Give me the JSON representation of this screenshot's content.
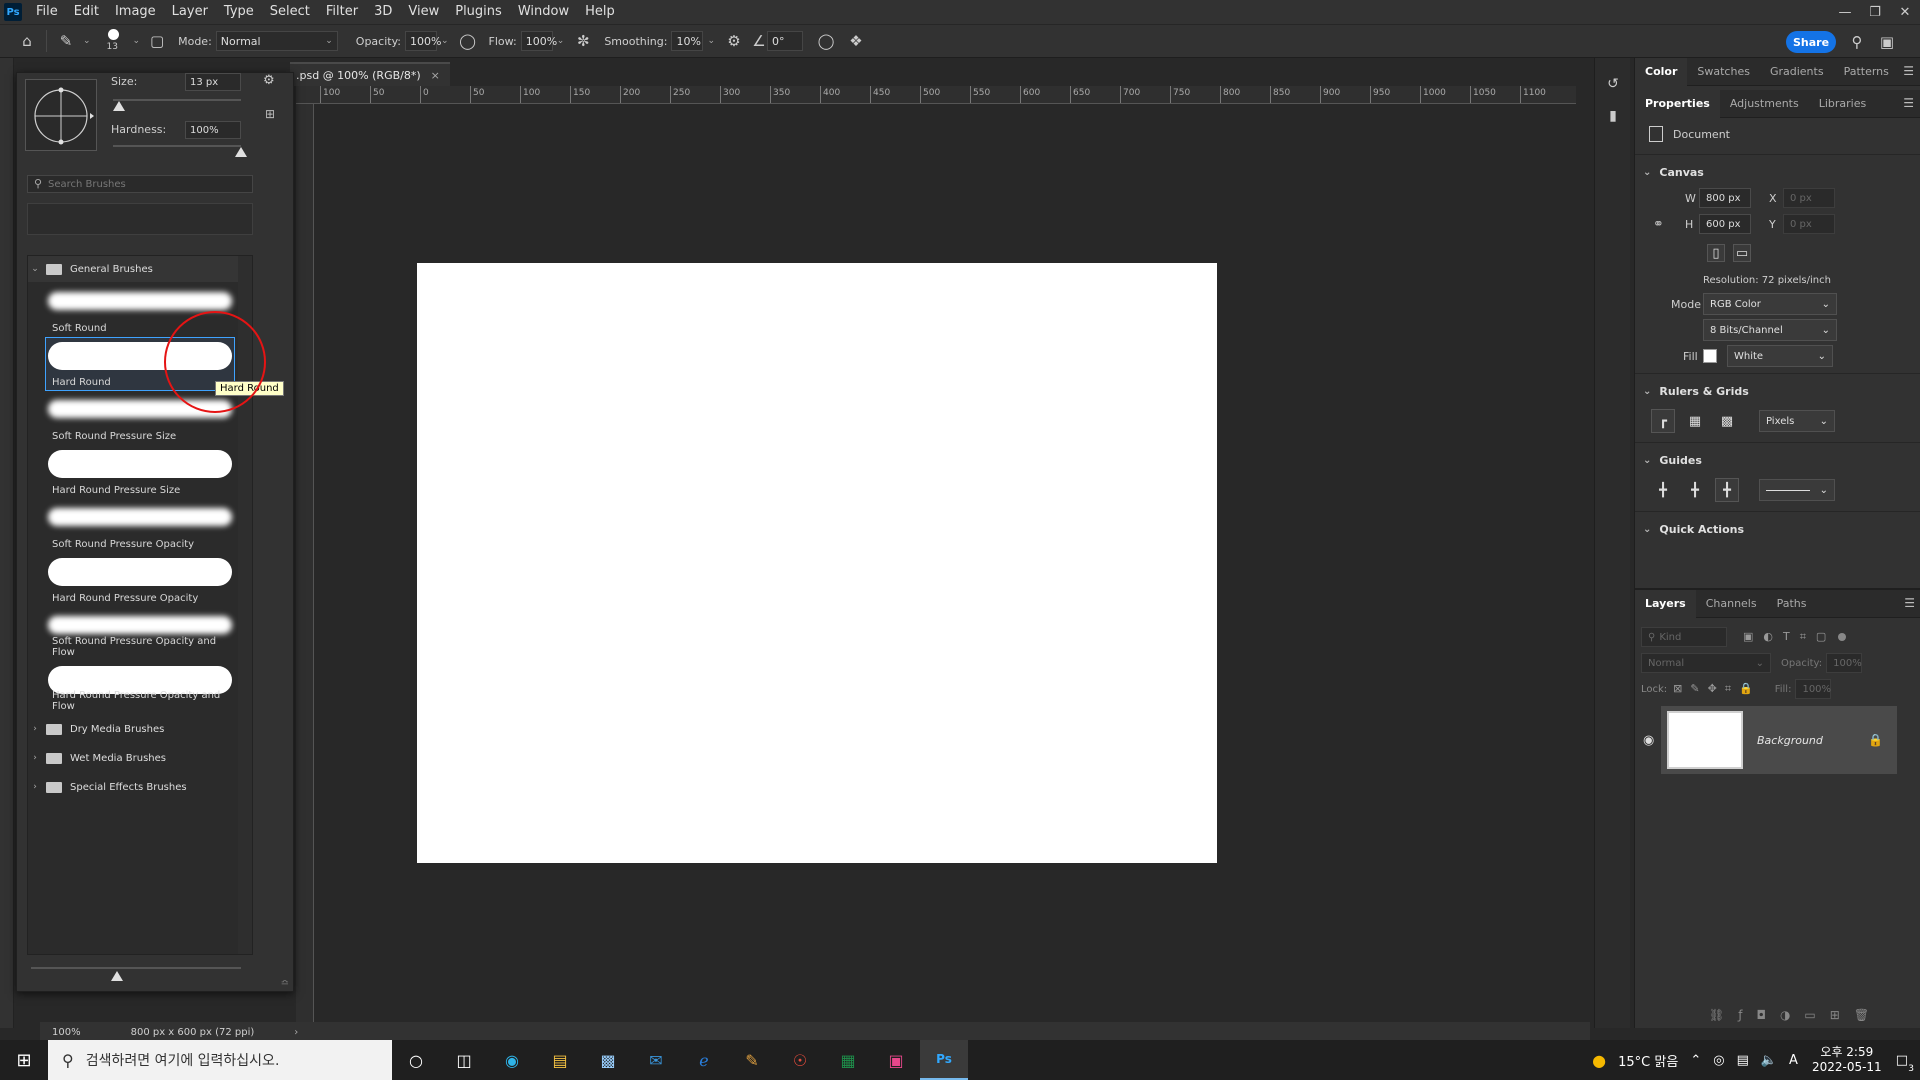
{
  "menubar": {
    "app_logo": "Ps",
    "items": [
      "File",
      "Edit",
      "Image",
      "Layer",
      "Type",
      "Select",
      "Filter",
      "3D",
      "View",
      "Plugins",
      "Window",
      "Help"
    ]
  },
  "options": {
    "brush_size_num": "13",
    "mode_label": "Mode:",
    "mode_value": "Normal",
    "opacity_label": "Opacity:",
    "opacity_value": "100%",
    "flow_label": "Flow:",
    "flow_value": "100%",
    "smoothing_label": "Smoothing:",
    "smoothing_value": "10%",
    "angle_value": "0°",
    "share_label": "Share"
  },
  "document": {
    "tab_title": ".psd @ 100% (RGB/8*)",
    "tab_close": "×",
    "zoom": "100%",
    "doc_info": "800 px x 600 px (72 ppi)",
    "ruler_labels": [
      "100",
      "50",
      "0",
      "50",
      "100",
      "150",
      "200",
      "250",
      "300",
      "350",
      "400",
      "450",
      "500",
      "550",
      "600",
      "650",
      "700",
      "750",
      "800",
      "850",
      "900",
      "950",
      "1000",
      "1050",
      "1100"
    ]
  },
  "brush_panel": {
    "size_label": "Size:",
    "size_value": "13 px",
    "hardness_label": "Hardness:",
    "hardness_value": "100%",
    "search_placeholder": "Search Brushes",
    "size_slider_fraction": 0.05,
    "hardness_slider_fraction": 1.0,
    "folders": {
      "general": "General Brushes",
      "dry": "Dry Media Brushes",
      "wet": "Wet Media Brushes",
      "special": "Special Effects Brushes"
    },
    "brushes": [
      {
        "name": "Soft Round",
        "kind": "soft"
      },
      {
        "name": "Hard Round",
        "kind": "hard"
      },
      {
        "name": "Soft Round Pressure Size",
        "kind": "soft"
      },
      {
        "name": "Hard Round Pressure Size",
        "kind": "hard"
      },
      {
        "name": "Soft Round Pressure Opacity",
        "kind": "soft"
      },
      {
        "name": "Hard Round Pressure Opacity",
        "kind": "hard"
      },
      {
        "name": "Soft Round Pressure Opacity and Flow",
        "kind": "soft"
      },
      {
        "name": "Hard Round Pressure Opacity and Flow",
        "kind": "hard"
      }
    ],
    "tooltip": "Hard Round"
  },
  "panels": {
    "color_tabs": [
      "Color",
      "Swatches",
      "Gradients",
      "Patterns"
    ],
    "props_tabs": [
      "Properties",
      "Adjustments",
      "Libraries"
    ],
    "document_label": "Document",
    "canvas": {
      "title": "Canvas",
      "w_label": "W",
      "w_value": "800 px",
      "h_label": "H",
      "h_value": "600 px",
      "x_label": "X",
      "x_placeholder": "0 px",
      "y_label": "Y",
      "y_placeholder": "0 px",
      "resolution": "Resolution: 72 pixels/inch",
      "mode_label": "Mode",
      "mode_value": "RGB Color",
      "bits_value": "8 Bits/Channel",
      "fill_label": "Fill",
      "fill_value": "White"
    },
    "rulers": {
      "title": "Rulers & Grids",
      "unit": "Pixels"
    },
    "guides": {
      "title": "Guides"
    },
    "quick_actions": {
      "title": "Quick Actions"
    },
    "layers_tabs": [
      "Layers",
      "Channels",
      "Paths"
    ],
    "layers": {
      "kind_placeholder": "Kind",
      "blend_mode": "Normal",
      "opacity_label": "Opacity:",
      "opacity_value": "100%",
      "lock_label": "Lock:",
      "fill_label": "Fill:",
      "fill_value": "100%",
      "background_name": "Background"
    }
  },
  "taskbar": {
    "search_text": "검색하려면 여기에 입력하십시오.",
    "weather": "15°C 맑음",
    "ime": "A",
    "time": "오후 2:59",
    "date": "2022-05-11",
    "notifications": "3"
  },
  "colors": {
    "accent": "#1473e6",
    "selection": "#3fa3ff",
    "annotation": "#e51414"
  }
}
